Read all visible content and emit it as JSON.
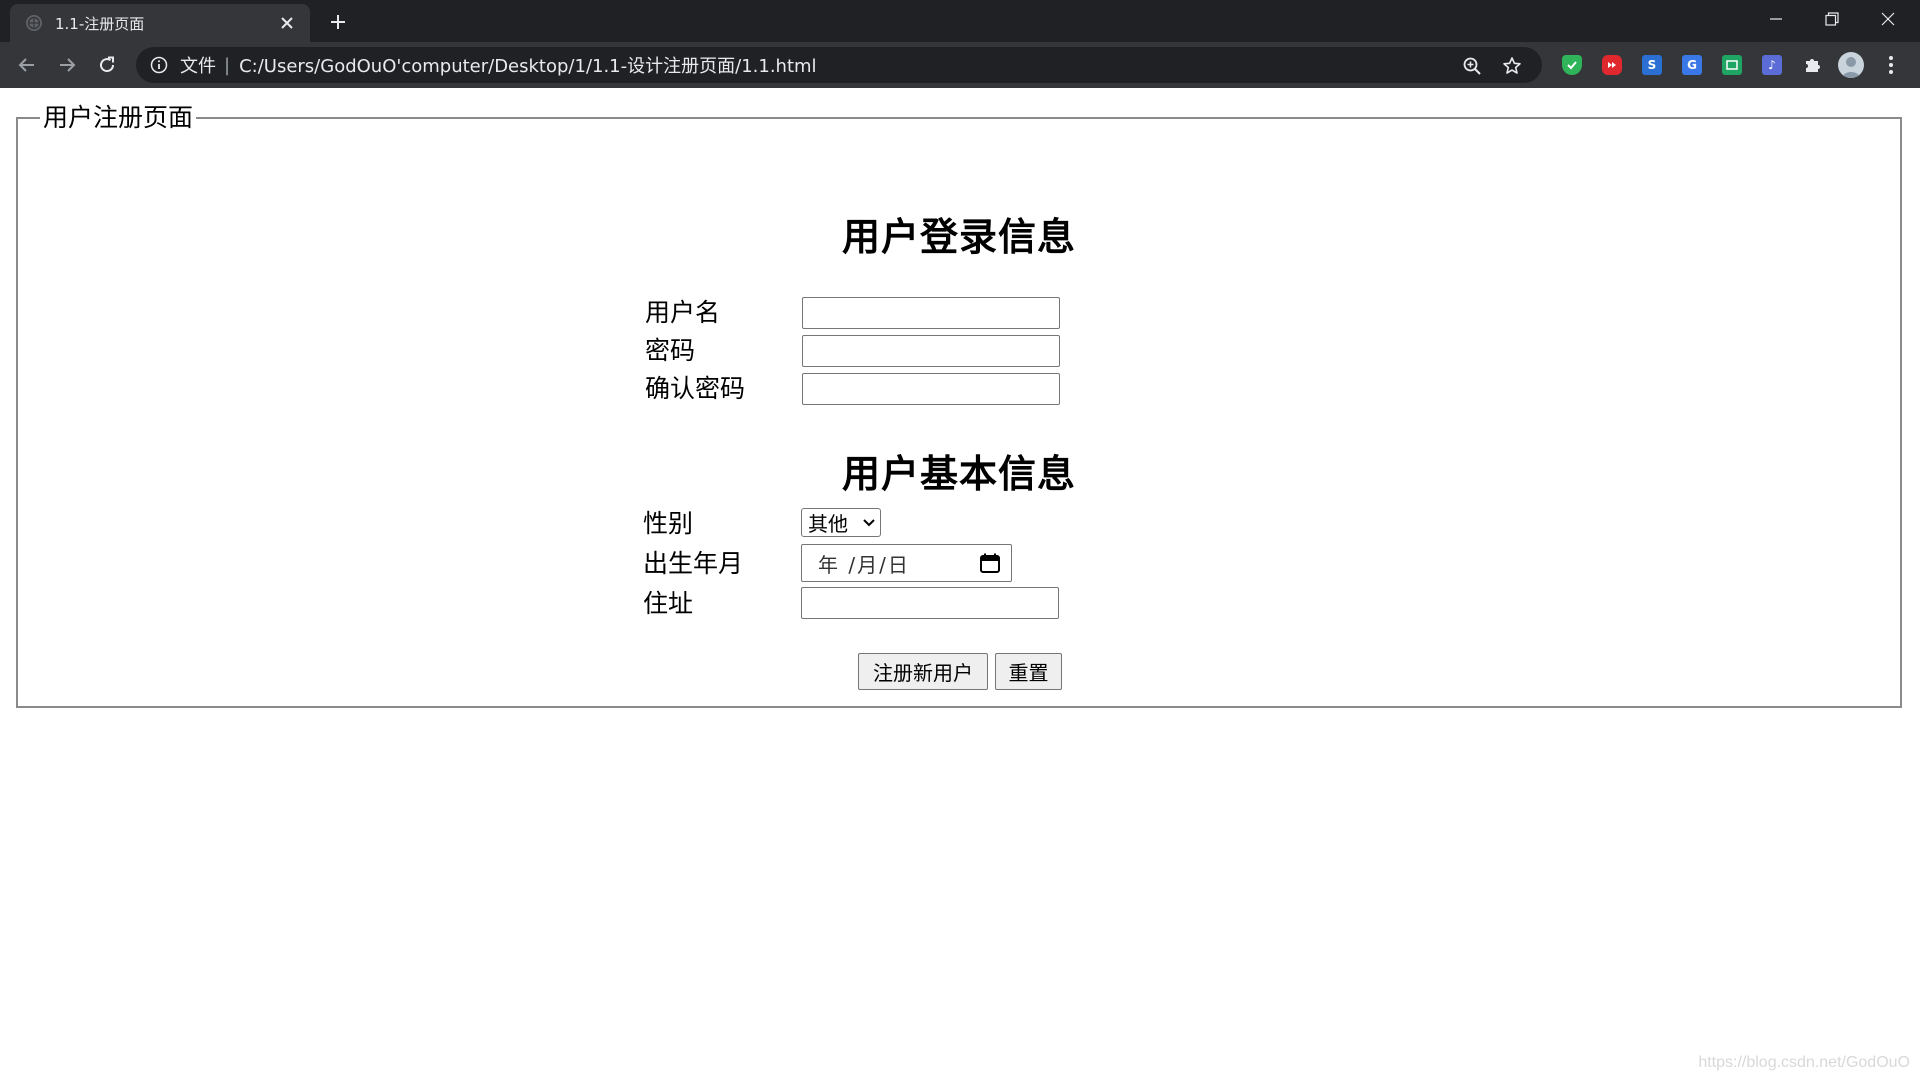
{
  "browser": {
    "tab_title": "1.1-注册页面",
    "omnibox": {
      "scheme_label": "文件",
      "separator": "|",
      "url": "C:/Users/GodOuO'computer/Desktop/1/1.1-设计注册页面/1.1.html"
    },
    "icons": {
      "favicon": "globe-icon",
      "tab_close": "close-icon",
      "new_tab": "plus-icon",
      "back": "arrow-left-icon",
      "forward": "arrow-right-icon",
      "reload": "reload-icon",
      "info": "info-icon",
      "zoom": "zoom-icon",
      "bookmark": "star-icon",
      "extensions": "puzzle-icon",
      "menu": "kebab-menu-icon"
    },
    "extension_colors": [
      "#2fb45a",
      "#e0282f",
      "#2a6fd1",
      "#3b78e7",
      "#1fa464",
      "#5b6cd6"
    ]
  },
  "page": {
    "legend": "用户注册页面",
    "login_section": {
      "heading": "用户登录信息",
      "username_label": "用户名",
      "username_value": "",
      "password_label": "密码",
      "password_value": "",
      "confirm_label": "确认密码",
      "confirm_value": ""
    },
    "basic_section": {
      "heading": "用户基本信息",
      "gender_label": "性别",
      "gender_selected": "其他",
      "birth_label": "出生年月",
      "birth_placeholder": "年 /月/日",
      "address_label": "住址",
      "address_value": ""
    },
    "buttons": {
      "register": "注册新用户",
      "reset": "重置"
    },
    "watermark": "https://blog.csdn.net/GodOuO"
  }
}
